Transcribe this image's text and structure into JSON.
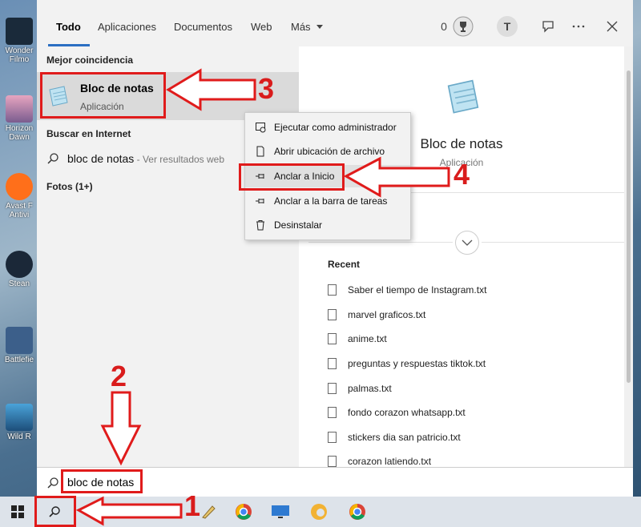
{
  "desktop": {
    "icons": [
      {
        "label": "Wonder Filmo"
      },
      {
        "label": "Horizon Dawn"
      },
      {
        "label": "Avast F Antivi"
      },
      {
        "label": "Stean"
      },
      {
        "label": "Battlefie"
      },
      {
        "label": "Wild R"
      }
    ]
  },
  "tabs": [
    {
      "label": "Todo"
    },
    {
      "label": "Aplicaciones"
    },
    {
      "label": "Documentos"
    },
    {
      "label": "Web"
    },
    {
      "label": "Más"
    }
  ],
  "topbar": {
    "points": "0",
    "avatar_letter": "T"
  },
  "left": {
    "best_match_title": "Mejor coincidencia",
    "best_name": "Bloc de notas",
    "best_sub": "Aplicación",
    "web_title": "Buscar en Internet",
    "web_query": "bloc de notas",
    "web_suffix": " - Ver resultados web",
    "photos": "Fotos (1+)"
  },
  "right": {
    "app_name": "Bloc de notas",
    "app_sub": "Aplicación",
    "recent_title": "Recent",
    "recent": [
      "Saber el tiempo de Instagram.txt",
      "marvel graficos.txt",
      "anime.txt",
      "preguntas y respuestas tiktok.txt",
      "palmas.txt",
      "fondo corazon whatsapp.txt",
      "stickers dia san patricio.txt",
      "corazon latiendo.txt"
    ]
  },
  "context_menu": [
    {
      "label": "Ejecutar como administrador",
      "icon": "shield-run-icon"
    },
    {
      "label": "Abrir ubicación de archivo",
      "icon": "file-location-icon"
    },
    {
      "label": "Anclar a Inicio",
      "icon": "pin-icon"
    },
    {
      "label": "Anclar a la barra de tareas",
      "icon": "pin-taskbar-icon"
    },
    {
      "label": "Desinstalar",
      "icon": "trash-icon"
    }
  ],
  "search": {
    "value": "bloc de notas"
  },
  "annotations": {
    "n1": "1",
    "n2": "2",
    "n3": "3",
    "n4": "4"
  },
  "colors": {
    "annotation_red": "#e01b1b",
    "accent_blue": "#2b6fc2"
  }
}
